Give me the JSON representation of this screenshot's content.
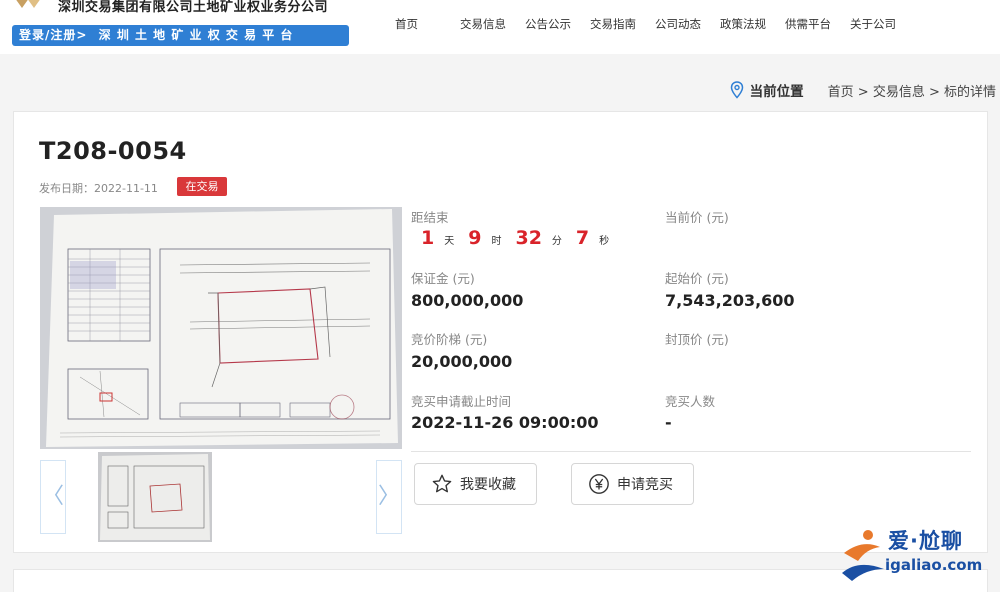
{
  "header": {
    "company": "深圳交易集团有限公司土地矿业权业务分公司",
    "login_link": "登录/注册>",
    "platform_name": "深 圳 土 地 矿 业 权 交 易 平 台",
    "nav": [
      "首页",
      "交易信息",
      "公告公示",
      "交易指南",
      "公司动态",
      "政策法规",
      "供需平台",
      "关于公司"
    ]
  },
  "breadcrumb": {
    "label": "当前位置",
    "path": "首页 > 交易信息 > 标的详情"
  },
  "listing": {
    "title": "T208-0054",
    "publish_label": "发布日期：",
    "publish_date": "2022-11-11",
    "status": "在交易",
    "countdown_label": "距结束",
    "countdown": {
      "days": "1",
      "days_unit": "天",
      "hours": "9",
      "hours_unit": "时",
      "minutes": "32",
      "minutes_unit": "分",
      "seconds": "7",
      "seconds_unit": "秒"
    },
    "current_price_label": "当前价 (元)",
    "current_price": "",
    "deposit_label": "保证金 (元)",
    "deposit": "800,000,000",
    "start_price_label": "起始价 (元)",
    "start_price": "7,543,203,600",
    "increment_label": "竞价阶梯 (元)",
    "increment": "20,000,000",
    "cap_price_label": "封顶价 (元)",
    "cap_price": "",
    "deadline_label": "竞买申请截止时间",
    "deadline": "2022-11-26 09:00:00",
    "bidders_label": "竞买人数",
    "bidders": "-",
    "favorite_label": "我要收藏",
    "apply_label": "申请竞买",
    "prev_glyph": "〈",
    "next_glyph": "〉"
  },
  "watermark": {
    "line1": "爱·尬聊",
    "line2": "igaliao.com"
  },
  "colors": {
    "brand_blue": "#2f7fd4",
    "status_red": "#d9383a",
    "countdown_red": "#d9232a"
  }
}
